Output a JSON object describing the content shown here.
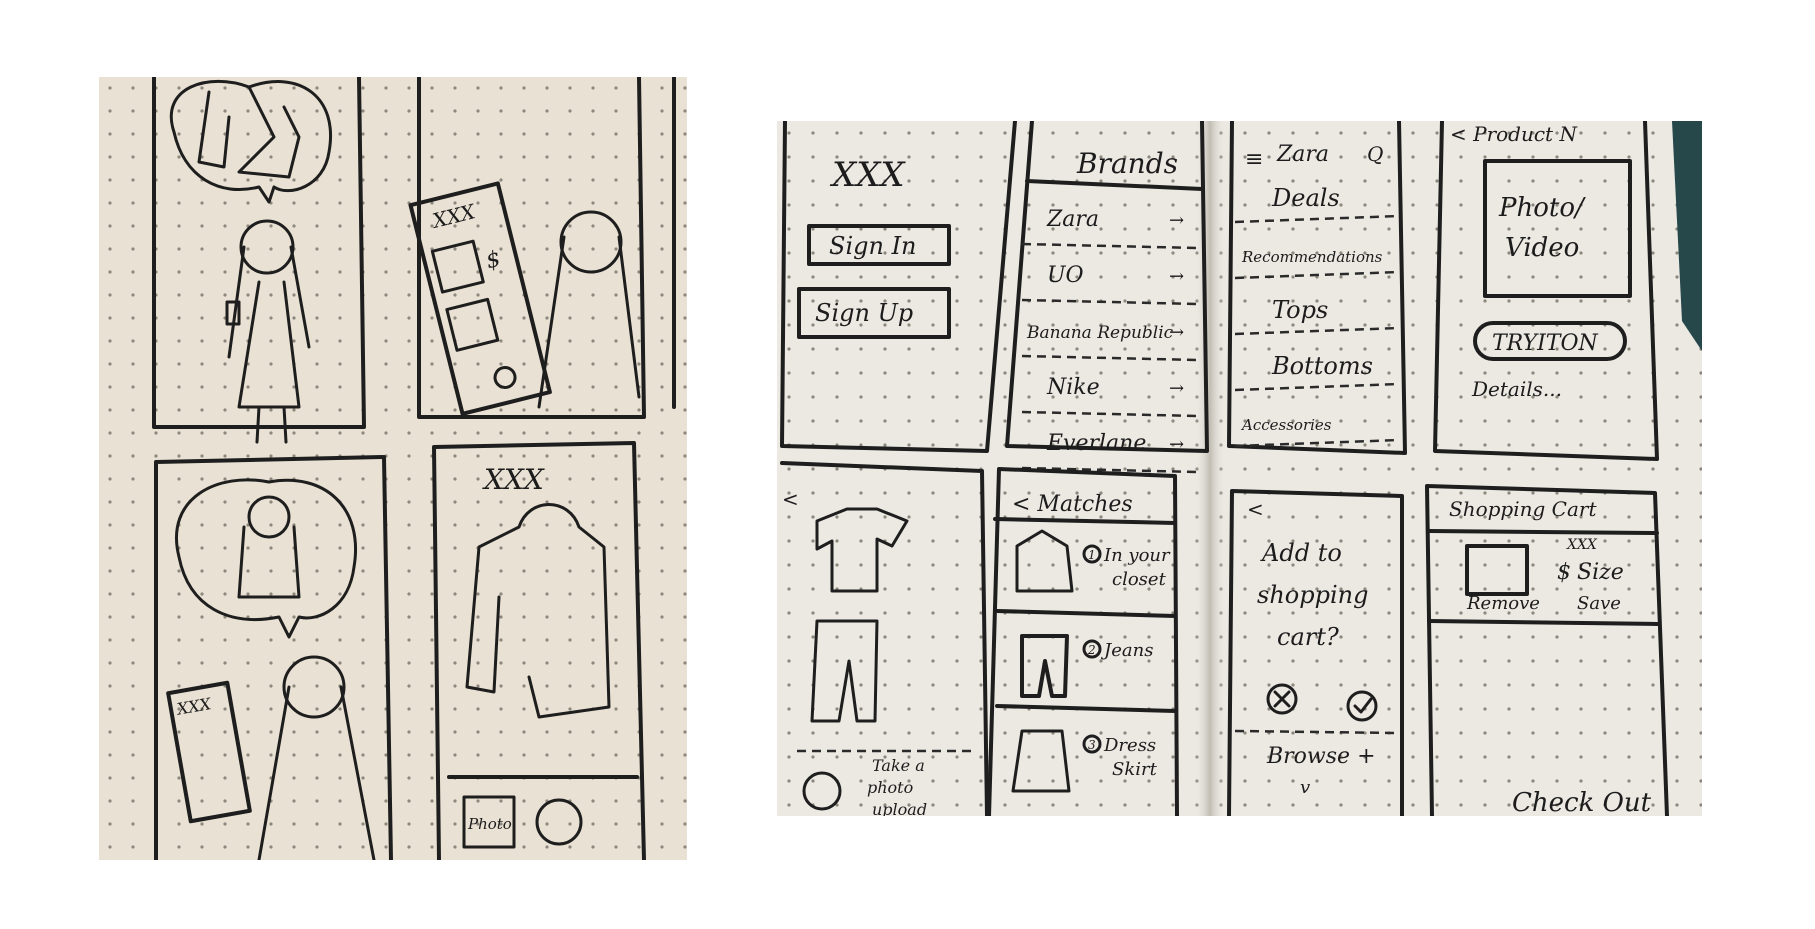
{
  "colors": {
    "paper_left": "#e9e1d3",
    "paper_right": "#ece9e3",
    "ink": "#1e1e1e",
    "dot": "#8d887e",
    "corner_teal": "#27484b"
  },
  "storyboard": {
    "panel_b_title": "XXX",
    "panel_c_card_title": "XXX",
    "panel_d_title": "XXX",
    "panel_d_photo_label": "Photo"
  },
  "wireframes": {
    "login": {
      "logo": "XXX",
      "sign_in": "Sign In",
      "sign_up": "Sign Up"
    },
    "brands": {
      "title": "Brands",
      "items": [
        "Zara",
        "UO",
        "Banana Republic",
        "Nike",
        "Everlane"
      ]
    },
    "store": {
      "store_name": "Zara",
      "items": [
        "Deals",
        "Recommendations",
        "Tops",
        "Bottoms",
        "Accessories"
      ]
    },
    "product": {
      "header": "< Product N",
      "media": [
        "Photo/",
        "Video"
      ],
      "tryiton": "TRYITON",
      "details": "Details..."
    },
    "closet": {
      "back": "<",
      "take_photo": [
        "Take a",
        "photo",
        "upload"
      ]
    },
    "matches": {
      "title": "< Matches",
      "items": [
        {
          "marker": "1",
          "label": "In your closet"
        },
        {
          "marker": "2",
          "label": "Jeans"
        },
        {
          "marker": "3",
          "label": "Dress Skirt"
        }
      ]
    },
    "add_to_cart": {
      "back": "<",
      "question": [
        "Add to",
        "shopping",
        "cart?"
      ],
      "browse": "Browse +"
    },
    "cart": {
      "title": "Shopping Cart",
      "item_name": "XXX",
      "price_symbol": "$",
      "size": "Size",
      "remove": "Remove",
      "save": "Save",
      "checkout": "Check Out"
    }
  }
}
